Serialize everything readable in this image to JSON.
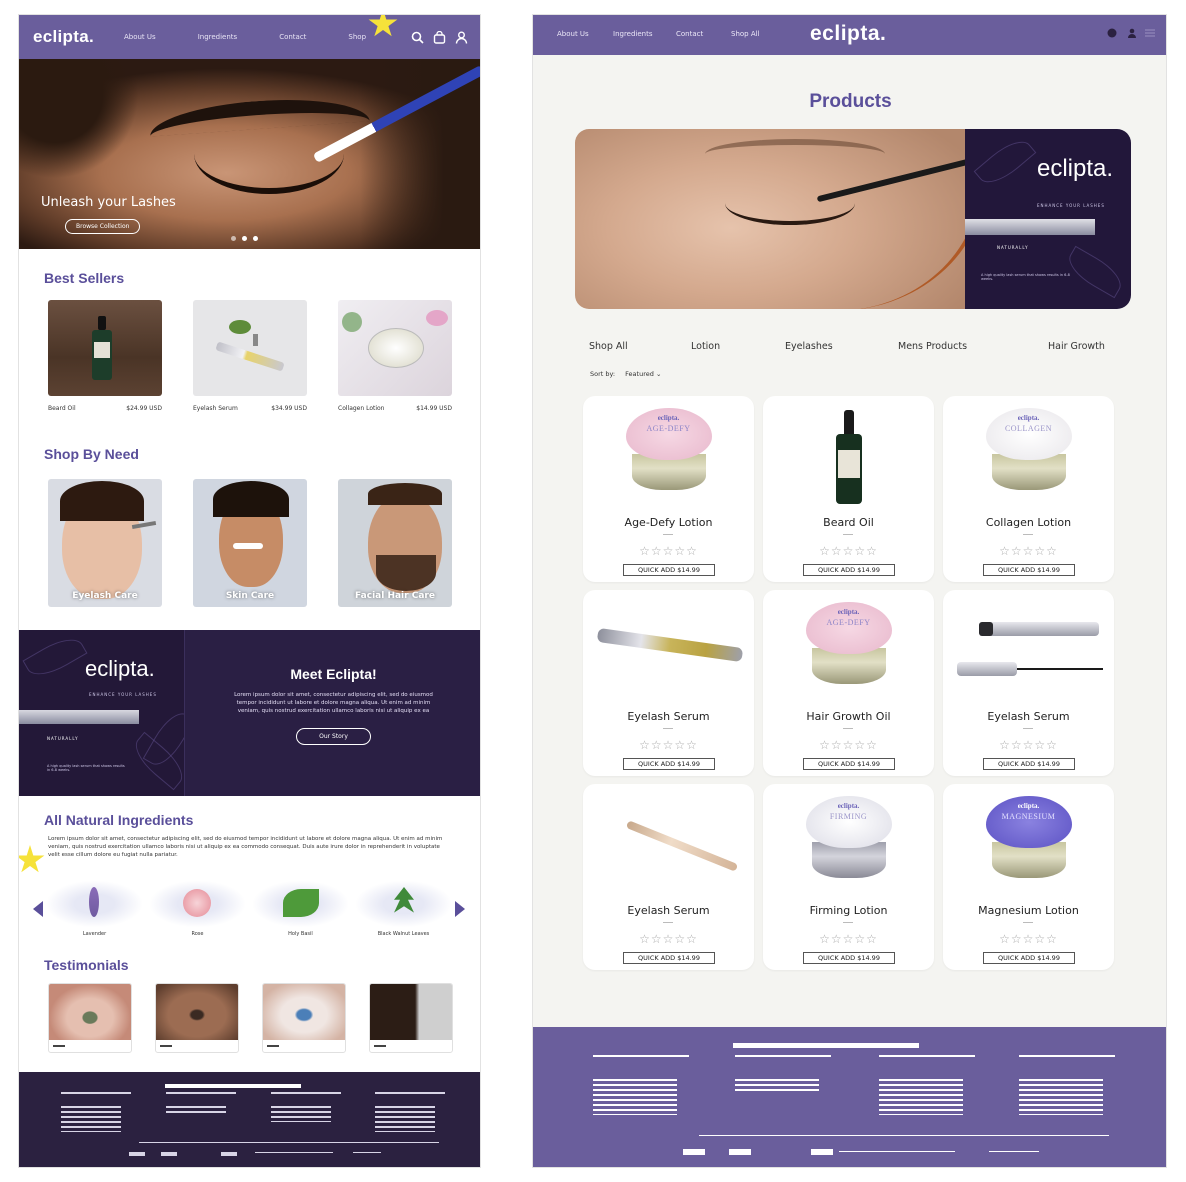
{
  "left": {
    "nav": {
      "logo": "eclipta.",
      "links": [
        "About Us",
        "Ingredients",
        "Contact",
        "Shop"
      ]
    },
    "hero": {
      "tagline": "Unleash your Lashes",
      "button": "Browse Collection"
    },
    "best_sellers": {
      "title": "Best Sellers",
      "items": [
        {
          "name": "Beard Oil",
          "price": "$24.99 USD"
        },
        {
          "name": "Eyelash Serum",
          "price": "$34.99 USD"
        },
        {
          "name": "Collagen Lotion",
          "price": "$14.99 USD"
        }
      ]
    },
    "shop_by_need": {
      "title": "Shop By Need",
      "items": [
        "Eyelash Care",
        "Skin Care",
        "Facial Hair Care"
      ]
    },
    "meet": {
      "brand": "eclipta.",
      "brand_sub": "ENHANCE YOUR LASHES",
      "brand_nat": "NATURALLY",
      "brand_tiny": "A high quality lash serum that shows results in 6-8 weeks.",
      "title": "Meet Eclipta!",
      "body": "Lorem ipsum dolor sit amet, consectetur adipiscing elit, sed do eiusmod tempor incididunt ut labore et dolore magna aliqua. Ut enim ad minim veniam, quis nostrud exercitation ullamco laboris nisi ut aliquip ex ea",
      "button": "Our Story"
    },
    "ingredients": {
      "title": "All Natural Ingredients",
      "body": "Lorem ipsum dolor sit amet, consectetur adipiscing elit, sed do eiusmod tempor incididunt ut labore et dolore magna aliqua. Ut enim ad minim veniam, quis nostrud exercitation ullamco laboris nisi ut aliquip ex ea commodo consequat. Duis aute irure dolor in reprehenderit in voluptate velit esse cillum dolore eu fugiat nulla pariatur.",
      "items": [
        "Lavender",
        "Rose",
        "Holy Basil",
        "Black Walnut Leaves"
      ]
    },
    "testimonials": {
      "title": "Testimonials"
    }
  },
  "right": {
    "nav": {
      "logo": "eclipta.",
      "links": [
        "About Us",
        "Ingredients",
        "Contact",
        "Shop All"
      ]
    },
    "page_title": "Products",
    "banner": {
      "brand": "eclipta.",
      "brand_sub": "ENHANCE YOUR LASHES",
      "brand_nat": "NATURALLY",
      "brand_tiny": "A high quality lash serum that shows results in 6-8 weeks."
    },
    "categories": [
      "Shop All",
      "Lotion",
      "Eyelashes",
      "Mens Products",
      "Hair Growth"
    ],
    "sort": {
      "label": "Sort by:",
      "value": "Featured"
    },
    "products": [
      {
        "name": "Age-Defy Lotion",
        "button": "QUICK ADD $14.99",
        "rating": 0
      },
      {
        "name": "Beard Oil",
        "button": "QUICK ADD $14.99",
        "rating": 0
      },
      {
        "name": "Collagen Lotion",
        "button": "QUICK ADD $14.99",
        "rating": 0
      },
      {
        "name": "Eyelash Serum",
        "button": "QUICK ADD $14.99",
        "rating": 0
      },
      {
        "name": "Hair Growth Oil",
        "button": "QUICK ADD $14.99",
        "rating": 0
      },
      {
        "name": "Eyelash Serum",
        "button": "QUICK ADD $14.99",
        "rating": 0
      },
      {
        "name": "Eyelash Serum",
        "button": "QUICK ADD $14.99",
        "rating": 0
      },
      {
        "name": "Firming Lotion",
        "button": "QUICK ADD $14.99",
        "rating": 0
      },
      {
        "name": "Magnesium Lotion",
        "button": "QUICK ADD $14.99",
        "rating": 0
      }
    ],
    "jar_labels": {
      "brand": "eclipta.",
      "age": "AGE-DEFY",
      "collagen": "COLLAGEN",
      "firming": "FIRMING",
      "magnesium": "MAGNESIUM"
    }
  },
  "colors": {
    "primary_purple": "#6a5e9c",
    "dark_purple": "#2a1f44",
    "title_purple": "#5a4f9a",
    "star_yellow": "#f6e23a"
  },
  "icons": [
    "search-icon",
    "bag-icon",
    "user-icon",
    "menu-icon",
    "star-rating-icon",
    "chevron-left-icon",
    "chevron-right-icon"
  ]
}
